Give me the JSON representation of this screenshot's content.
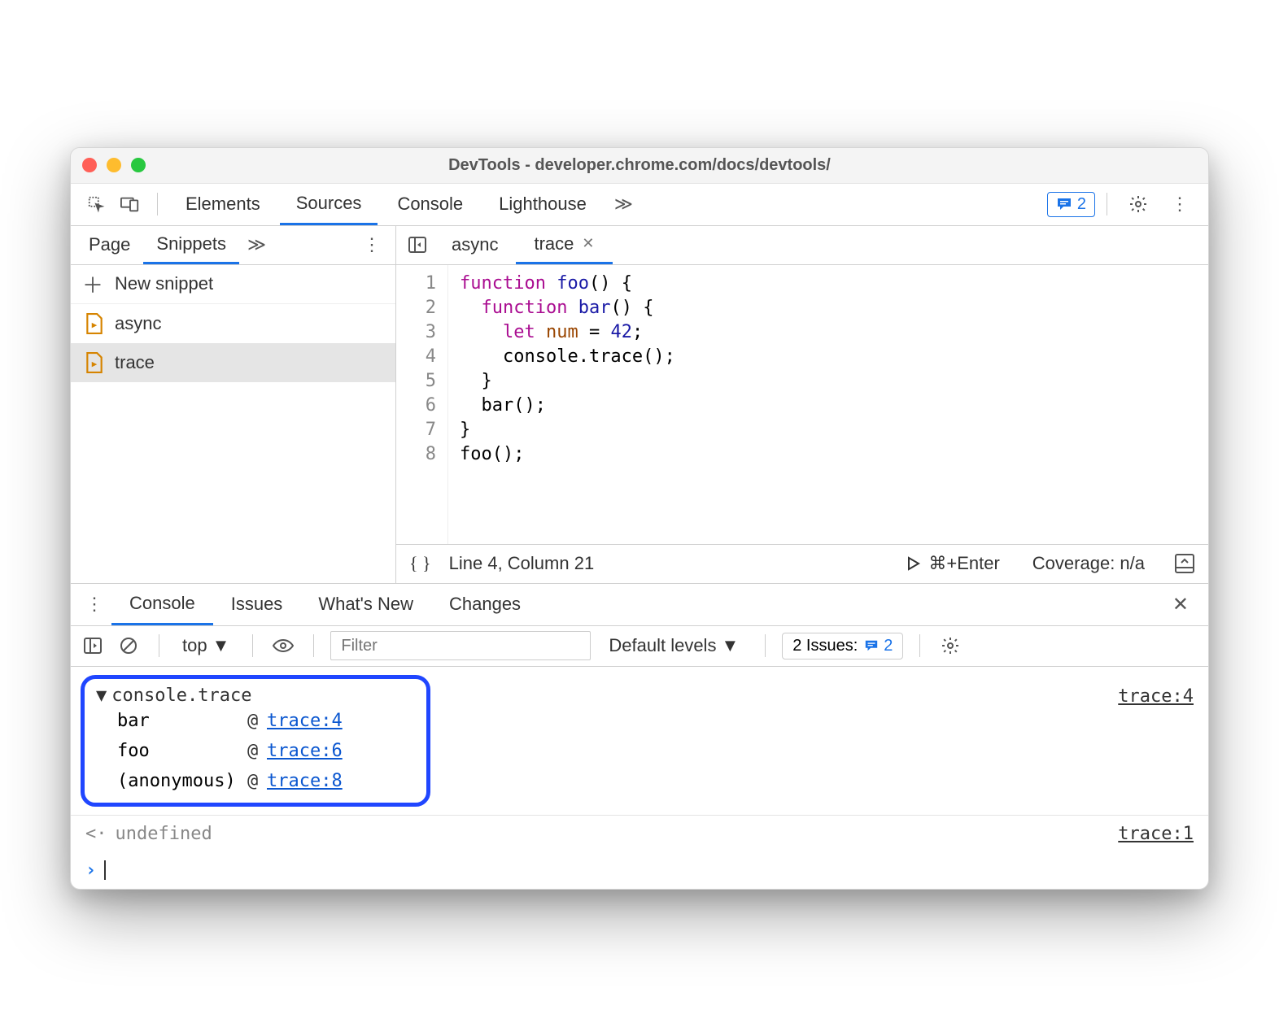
{
  "window": {
    "title": "DevTools - developer.chrome.com/docs/devtools/"
  },
  "mainTabs": {
    "items": [
      "Elements",
      "Sources",
      "Console",
      "Lighthouse"
    ],
    "activeIndex": 1,
    "issuesCount": "2"
  },
  "sidebar": {
    "tabs": [
      "Page",
      "Snippets"
    ],
    "activeIndex": 1,
    "newSnippetLabel": "New snippet",
    "files": [
      "async",
      "trace"
    ],
    "selectedIndex": 1
  },
  "editor": {
    "tabs": [
      {
        "label": "async",
        "active": false,
        "closable": false
      },
      {
        "label": "trace",
        "active": true,
        "closable": true
      }
    ],
    "lineCount": 8
  },
  "code": {
    "l1a": "function",
    "l1b": "foo",
    "l1c": "() {",
    "l2a": "function",
    "l2b": "bar",
    "l2c": "() {",
    "l3a": "let",
    "l3b": "num",
    "l3c": " = ",
    "l3d": "42",
    "l3e": ";",
    "l4a": "console.trace();",
    "l5a": "}",
    "l6a": "bar();",
    "l7a": "}",
    "l8a": "foo();"
  },
  "statusBar": {
    "position": "Line 4, Column 21",
    "runHint": "⌘+Enter",
    "coverage": "Coverage: n/a"
  },
  "drawer": {
    "tabs": [
      "Console",
      "Issues",
      "What's New",
      "Changes"
    ],
    "activeIndex": 0
  },
  "consoleToolbar": {
    "context": "top",
    "filterPlaceholder": "Filter",
    "levels": "Default levels",
    "issuesLabel": "2 Issues:",
    "issuesCount": "2"
  },
  "trace": {
    "header": "console.trace",
    "sourceLink": "trace:4",
    "stack": [
      {
        "fn": "bar",
        "link": "trace:4"
      },
      {
        "fn": "foo",
        "link": "trace:6"
      },
      {
        "fn": "(anonymous)",
        "link": "trace:8"
      }
    ]
  },
  "consoleReturn": {
    "value": "undefined",
    "sourceLink": "trace:1"
  }
}
